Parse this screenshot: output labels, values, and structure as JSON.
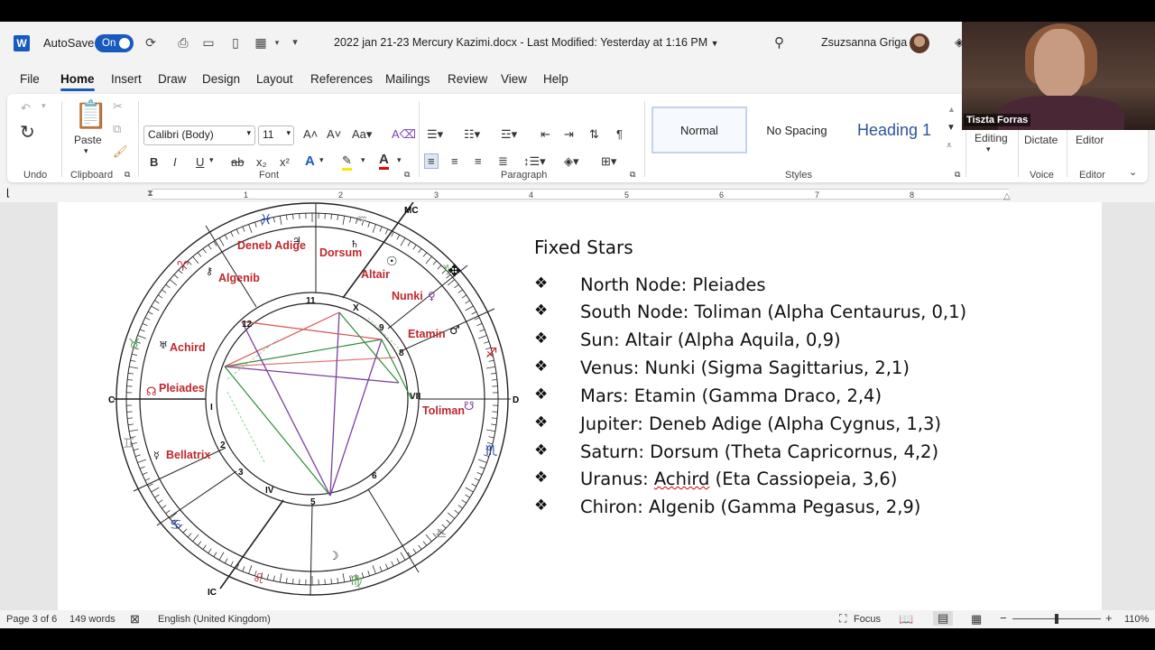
{
  "titlebar": {
    "app_icon": "W",
    "autosave_label": "AutoSave",
    "autosave_state": "On",
    "document_title": "2022 jan 21-23 Mercury Kazimi.docx",
    "last_modified": "Last Modified: Yesterday at 1:16 PM",
    "user_name": "Zsuzsanna Griga"
  },
  "menu": {
    "items": [
      "File",
      "Home",
      "Insert",
      "Draw",
      "Design",
      "Layout",
      "References",
      "Mailings",
      "Review",
      "View",
      "Help"
    ],
    "active": "Home"
  },
  "ribbon": {
    "undo_group": "Undo",
    "clipboard_group": "Clipboard",
    "paste_label": "Paste",
    "font_name": "Calibri (Body)",
    "font_size": "11",
    "font_group": "Font",
    "paragraph_group": "Paragraph",
    "styles": [
      "Normal",
      "No Spacing",
      "Heading 1"
    ],
    "styles_group": "Styles",
    "editing_label": "Editing",
    "dictate_label": "Dictate",
    "voice_group": "Voice",
    "editor_label": "Editor",
    "editor_group": "Editor",
    "bold": "B",
    "italic": "I",
    "underline": "U",
    "strike": "ab",
    "subscript": "x₂",
    "superscript": "x²"
  },
  "ruler": {
    "numbers": [
      "1",
      "2",
      "3",
      "4",
      "5",
      "6",
      "7",
      "8"
    ]
  },
  "chart_wheel": {
    "angles": [
      "MC",
      "IC",
      "C",
      "D"
    ],
    "star_labels": [
      "Deneb Adige",
      "Dorsum",
      "Altair",
      "Algenib",
      "Nunki",
      "Etamin",
      "Achird",
      "Pleiades",
      "Toliman",
      "Bellatrix"
    ],
    "house_numbers": [
      "11",
      "12",
      "X",
      "9",
      "8",
      "VII",
      "I",
      "2",
      "3",
      "IV",
      "5",
      "6"
    ]
  },
  "document": {
    "heading": "Fixed Stars",
    "bullet": "❖",
    "items": [
      "North Node: Pleiades",
      "South Node: Toliman (Alpha Centaurus, 0,1)",
      "Sun: Altair (Alpha Aquila, 0,9)",
      "Venus: Nunki (Sigma Sagittarius, 2,1)",
      "Mars: Etamin (Gamma Draco, 2,4)",
      "Jupiter: Deneb Adige (Alpha Cygnus, 1,3)",
      "Saturn: Dorsum (Theta Capricornus, 4,2)",
      "Uranus: Achird (Eta Cassiopeia, 3,6)",
      "Chiron: Algenib (Gamma Pegasus, 2,9)"
    ]
  },
  "statusbar": {
    "page": "Page 3 of 6",
    "words": "149 words",
    "language": "English (United Kingdom)",
    "focus": "Focus",
    "zoom": "110%"
  },
  "video": {
    "participant": "Tiszta Forras"
  },
  "colors": {
    "accent": "#185abd",
    "star_label": "#c0272d",
    "glyph_blue": "#1a3fa8"
  }
}
